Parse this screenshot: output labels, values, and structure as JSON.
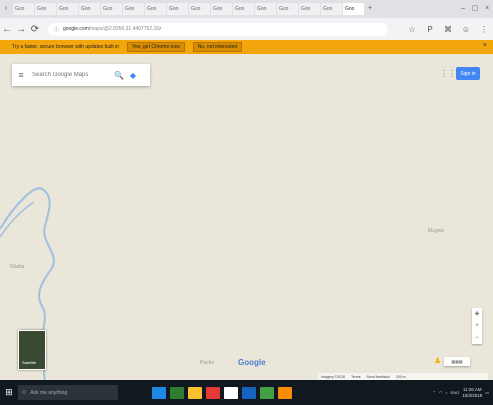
{
  "browser": {
    "tabs": [
      {
        "label": "Goo"
      },
      {
        "label": "Goo"
      },
      {
        "label": "Goo"
      },
      {
        "label": "Goo"
      },
      {
        "label": "Goo"
      },
      {
        "label": "Goo"
      },
      {
        "label": "Goo"
      },
      {
        "label": "Goo"
      },
      {
        "label": "Goo"
      },
      {
        "label": "Goo"
      },
      {
        "label": "Goo"
      },
      {
        "label": "Goo"
      },
      {
        "label": "Goo"
      },
      {
        "label": "Goo"
      },
      {
        "label": "Goo"
      },
      {
        "label": "Goo"
      }
    ],
    "tab_close_glyph": "×",
    "new_tab_glyph": "+",
    "url_host": "google.com",
    "url_path": "/maps/@2.8356,31.4407762,15z",
    "back_glyph": "←",
    "forward_glyph": "→",
    "reload_glyph": "⟳",
    "lock_glyph": "ⓘ"
  },
  "infobar": {
    "message": "Try a faster, secure browser with updates built in",
    "primary_button": "Yes, get Chrome now",
    "secondary_button": "No, not interested",
    "close_glyph": "×"
  },
  "map": {
    "search_placeholder": "Search Google Maps",
    "menu_glyph": "≡",
    "search_glyph": "🔍",
    "directions_glyph": "◆",
    "apps_glyph": "⋮⋮",
    "signin_label": "Sign in",
    "place_labels": [
      "Nkaba",
      "Mugwo",
      "Pacho"
    ],
    "satellite_label": "Satellite",
    "logo": "Google",
    "zoom_in": "+",
    "zoom_out": "−",
    "compass": "◈",
    "attribution": [
      "Imagery ©2018",
      "Terms",
      "Send feedback",
      "200 m"
    ]
  },
  "taskbar": {
    "search_placeholder": "Ask me anything",
    "start_glyph": "⊞",
    "time": "11:26 AM",
    "date": "10/3/2018",
    "tray_text": "ENG",
    "app_colors": [
      "#1e88e5",
      "#2e7d32",
      "#fbc02d",
      "#e53935",
      "#ffffff",
      "#1565c0",
      "#43a047",
      "#fb8c00"
    ]
  },
  "colors": {
    "infobar": "#f3a50c",
    "map_background": "#ebe6da",
    "river": "#9fc0de",
    "accent": "#4285f4"
  }
}
